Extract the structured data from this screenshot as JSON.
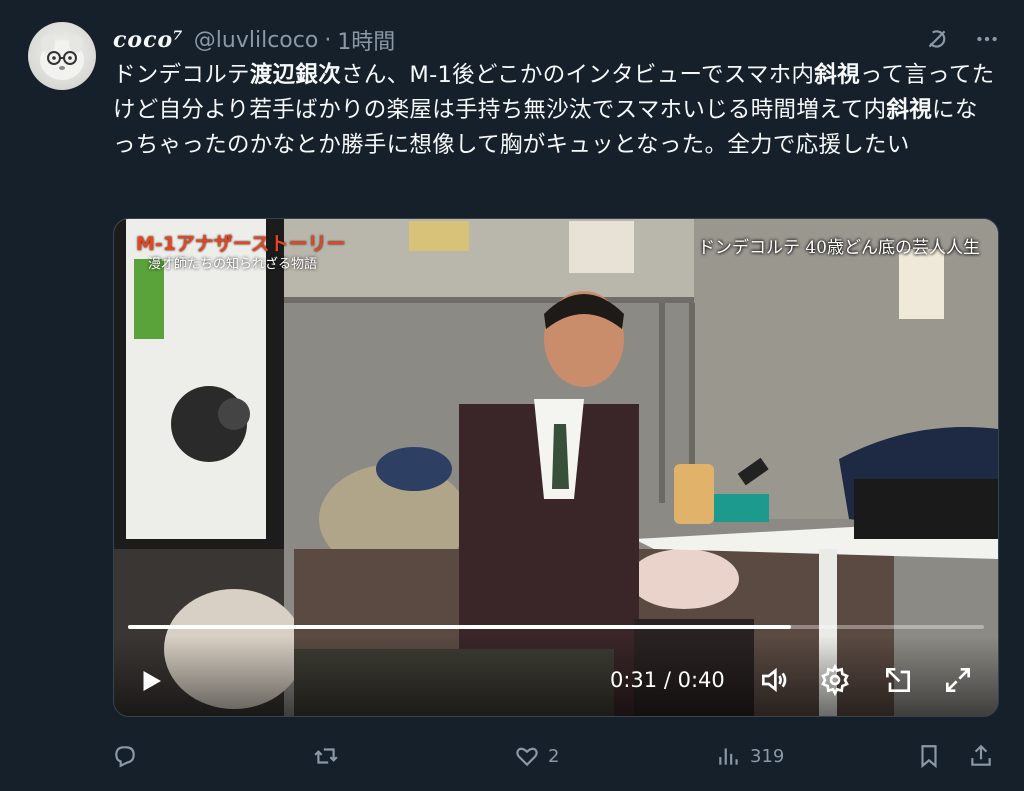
{
  "tweet": {
    "display_name": "𝒄𝒐𝒄𝒐⁷",
    "handle": "@luvlilcoco",
    "separator": "·",
    "time": "1時間",
    "text_parts": {
      "p1": "ドンデコルテ",
      "p2": "渡辺銀次",
      "p3": "さん、M-1後どこかのインタビューでスマホ内",
      "p4": "斜視",
      "p5": "って言ってたけど自分より若手ばかりの楽屋は手持ち無沙汰でスマホいじる時間増えて内",
      "p6": "斜視",
      "p7": "になっちゃったのかなとか勝手に想像して胸がキュッとなった。全力で応援したい"
    }
  },
  "video": {
    "overlay_title": "M-1アナザーストーリー",
    "overlay_subtitle": "漫才師たちの知られざる物語",
    "overlay_caption": "ドンデコルテ 40歳どん底の芸人人生",
    "time_readout": "0:31 / 0:40",
    "progress_fraction": 0.775
  },
  "actions": {
    "reply_count": "",
    "retweet_count": "",
    "like_count": "2",
    "views_count": "319"
  },
  "colors": {
    "background": "#15202b",
    "text": "#f7f9f9",
    "muted": "#8b98a5"
  }
}
